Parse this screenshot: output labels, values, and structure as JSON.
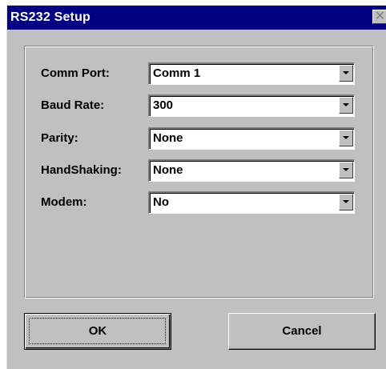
{
  "window": {
    "title": "RS232 Setup",
    "close_glyph": "✕"
  },
  "fields": [
    {
      "label": "Comm Port:",
      "value": "Comm 1"
    },
    {
      "label": "Baud Rate:",
      "value": "300"
    },
    {
      "label": "Parity:",
      "value": "None"
    },
    {
      "label": "HandShaking:",
      "value": "None"
    },
    {
      "label": "Modem:",
      "value": "No"
    }
  ],
  "buttons": {
    "ok_label": "OK",
    "cancel_label": "Cancel"
  },
  "icons": {
    "close": "close-icon",
    "dropdown": "chevron-down-icon"
  },
  "colors": {
    "titlebar": "#000080",
    "face": "#c0c0c0"
  }
}
